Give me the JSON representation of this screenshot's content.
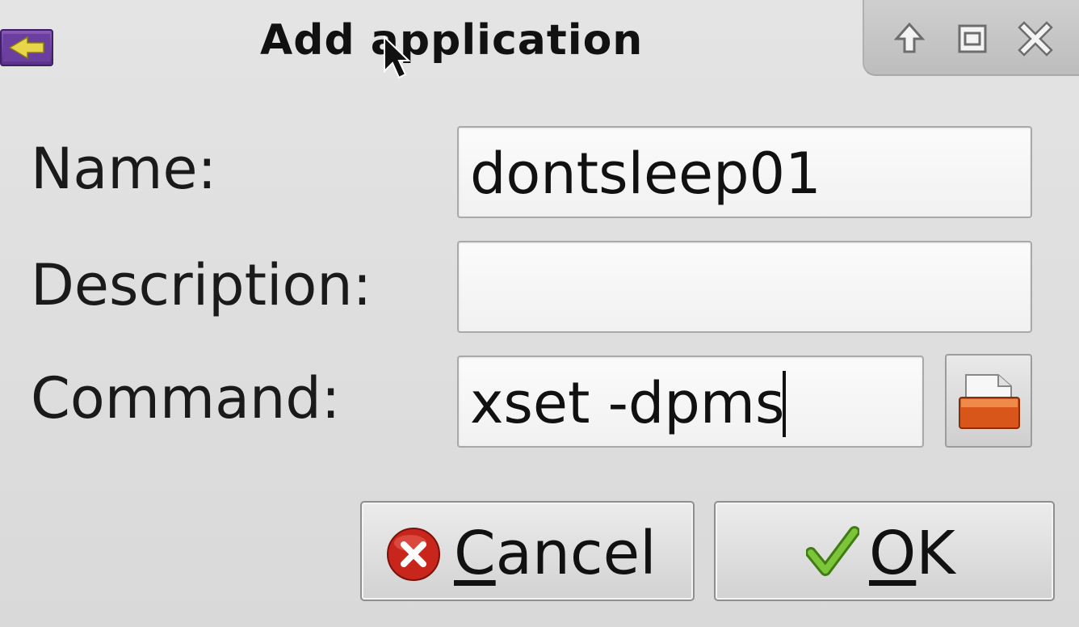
{
  "window": {
    "title": "Add application"
  },
  "titlebar": {
    "app_icon": "app-launcher-icon",
    "buttons": [
      {
        "name": "shade",
        "icon": "arrow-up-icon"
      },
      {
        "name": "maximize",
        "icon": "maximize-icon"
      },
      {
        "name": "close",
        "icon": "close-icon"
      }
    ]
  },
  "form": {
    "name_label": "Name:",
    "name_value": "dontsleep01",
    "description_label": "Description:",
    "description_value": "",
    "command_label": "Command:",
    "command_value": "xset -dpms",
    "browse_icon": "open-file-icon"
  },
  "buttons": {
    "cancel_mnemonic": "C",
    "cancel_rest": "ancel",
    "cancel_icon": "cancel-icon",
    "ok_mnemonic": "O",
    "ok_rest": "K",
    "ok_icon": "checkmark-icon"
  },
  "colors": {
    "cancel_red": "#c8261c",
    "ok_green": "#5aa51e",
    "browse_orange": "#d8561a"
  }
}
